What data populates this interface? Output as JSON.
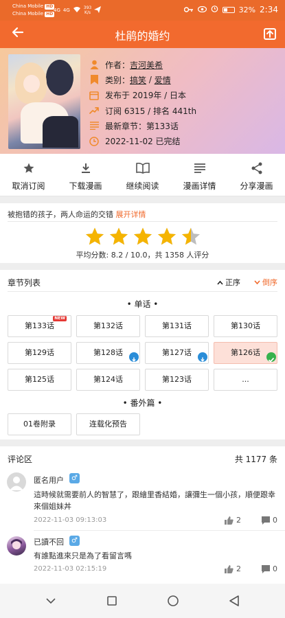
{
  "status_bar": {
    "carrier1": "China Mobile",
    "carrier2": "China Mobile",
    "hd_label": "HD",
    "net1": "4G",
    "net2": "4G",
    "speed": "393",
    "speed_unit": "K/s",
    "battery": "32%",
    "time": "2:34"
  },
  "app_bar": {
    "title": "杜鹃的婚约"
  },
  "info": {
    "author_prefix": "作者：",
    "author": "吉河美希",
    "category_prefix": "类别：",
    "category1": "搞笑",
    "category_sep": " / ",
    "category2": "爱情",
    "published": "发布于 2019年 / 日本",
    "subscriptions": "订阅 6315 / 排名 441th",
    "latest": "最新章节：第133话",
    "updated": "2022-11-02 已完结"
  },
  "actions": [
    {
      "label": "取消订阅",
      "icon": "star-icon"
    },
    {
      "label": "下载漫画",
      "icon": "download-icon"
    },
    {
      "label": "继续阅读",
      "icon": "book-icon"
    },
    {
      "label": "漫画详情",
      "icon": "list-icon"
    },
    {
      "label": "分享漫画",
      "icon": "share-icon"
    }
  ],
  "description": {
    "text": "被抱错的孩子，两人命运的交错",
    "more": "展开详情"
  },
  "rating": {
    "stars": 4.5,
    "max": 5,
    "text": "平均分数: 8.2 / 10.0，共 1358 人评分"
  },
  "chapters": {
    "title": "章节列表",
    "sort_asc": "正序",
    "sort_desc": "倒序",
    "group_main": "• 单话 •",
    "group_extra": "• 番外篇 •",
    "new_badge": "NEW",
    "main": [
      "第133话",
      "第132话",
      "第131话",
      "第130话",
      "第129话",
      "第128话",
      "第127话",
      "第126话",
      "第125话",
      "第124话",
      "第123话",
      "..."
    ],
    "extra": [
      "01卷附录",
      "连载化预告"
    ]
  },
  "comments": {
    "title": "评论区",
    "count": "共 1177 条",
    "gender_male": "♂",
    "items": [
      {
        "user": "匿名用户",
        "text": "這時候就需要前人的智慧了，跟繪里香結婚，讓彌生一個小孩，順便跟幸來個姐妹丼",
        "time": "2022-11-03 09:13:03",
        "likes": "2",
        "replies": "0"
      },
      {
        "user": "已讀不回",
        "text": "有誰點進來只是為了看留言嗎",
        "time": "2022-11-03 02:15:19",
        "likes": "2",
        "replies": "0"
      }
    ]
  },
  "colors": {
    "accent": "#f26a2e",
    "link": "#f06a2c",
    "star": "#f5b400",
    "download_badge": "#2a8dd8",
    "read_badge": "#37b24d"
  }
}
